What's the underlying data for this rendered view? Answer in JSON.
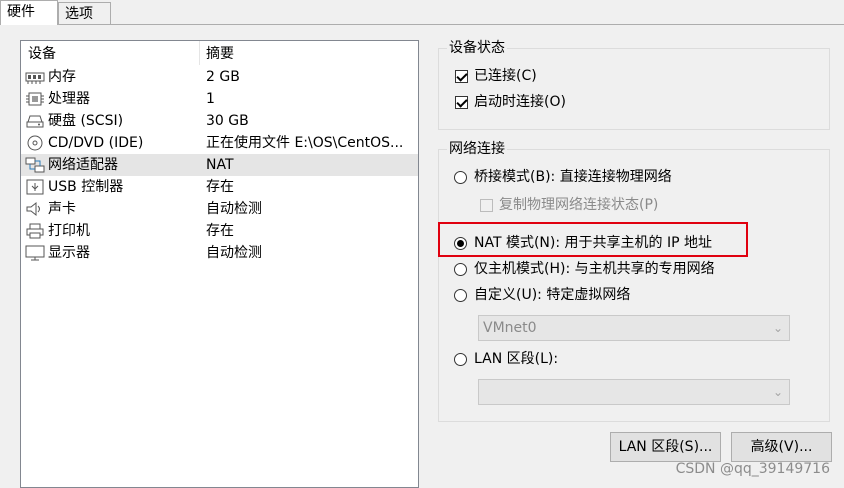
{
  "tabs": [
    {
      "label": "硬件",
      "active": true
    },
    {
      "label": "选项",
      "active": false
    }
  ],
  "device_list": {
    "columns": [
      "设备",
      "摘要"
    ],
    "rows": [
      {
        "name": "内存",
        "summary": "2 GB",
        "icon": "memory-icon"
      },
      {
        "name": "处理器",
        "summary": "1",
        "icon": "cpu-icon"
      },
      {
        "name": "硬盘 (SCSI)",
        "summary": "30 GB",
        "icon": "harddisk-icon"
      },
      {
        "name": "CD/DVD (IDE)",
        "summary": "正在使用文件 E:\\OS\\CentOS...",
        "icon": "cd-dvd-icon"
      },
      {
        "name": "网络适配器",
        "summary": "NAT",
        "icon": "network-adapter-icon",
        "selected": true
      },
      {
        "name": "USB 控制器",
        "summary": "存在",
        "icon": "usb-icon"
      },
      {
        "name": "声卡",
        "summary": "自动检测",
        "icon": "sound-icon"
      },
      {
        "name": "打印机",
        "summary": "存在",
        "icon": "printer-icon"
      },
      {
        "name": "显示器",
        "summary": "自动检测",
        "icon": "monitor-icon"
      }
    ]
  },
  "device_status": {
    "title": "设备状态",
    "connected": {
      "label": "已连接(C)",
      "checked": true
    },
    "connect_at_power_on": {
      "label": "启动时连接(O)",
      "checked": true
    }
  },
  "network_connection": {
    "title": "网络连接",
    "bridged": {
      "label": "桥接模式(B): 直接连接物理网络",
      "checked": false
    },
    "replicate": {
      "label": "复制物理网络连接状态(P)",
      "checked": false,
      "disabled": true
    },
    "nat": {
      "label": "NAT 模式(N): 用于共享主机的 IP 地址",
      "checked": true
    },
    "host_only": {
      "label": "仅主机模式(H): 与主机共享的专用网络",
      "checked": false
    },
    "custom": {
      "label": "自定义(U): 特定虚拟网络",
      "checked": false
    },
    "custom_select": {
      "value": "VMnet0"
    },
    "lan_segment": {
      "label": "LAN 区段(L):",
      "checked": false
    },
    "lan_select": {
      "value": ""
    }
  },
  "buttons": {
    "lan_segments": "LAN 区段(S)...",
    "advanced": "高级(V)..."
  },
  "watermark": "CSDN @qq_39149716",
  "colors": {
    "highlight": "#e0000f",
    "selected_row": "#e5e5e5"
  }
}
